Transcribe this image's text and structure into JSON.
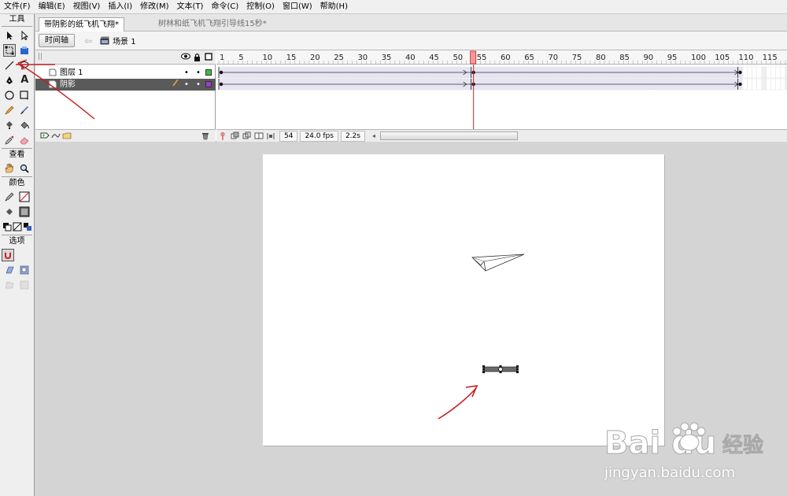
{
  "menu": [
    "文件(F)",
    "编辑(E)",
    "视图(V)",
    "插入(I)",
    "修改(M)",
    "文本(T)",
    "命令(C)",
    "控制(O)",
    "窗口(W)",
    "帮助(H)"
  ],
  "tools": {
    "title": "工具",
    "view_title": "查看",
    "color_title": "颜色",
    "options_title": "选项"
  },
  "tabs": {
    "active": "带阴影的纸飞机飞翔*",
    "inactive": "树林和纸飞机飞翔引导线15秒*"
  },
  "editbar": {
    "timeline_button": "时间轴",
    "scene": "场景 1"
  },
  "timeline": {
    "ruler_numbers": [
      "1",
      "5",
      "10",
      "15",
      "20",
      "25",
      "30",
      "35",
      "40",
      "45",
      "50",
      "55",
      "60",
      "65",
      "70",
      "75",
      "80",
      "85",
      "90",
      "95",
      "100",
      "105",
      "110",
      "115"
    ],
    "playhead_frame": 54,
    "total_frames_shown": 120,
    "layers": [
      {
        "name": "图层 1",
        "dot1": "•",
        "dot2": "•",
        "color": "#3cc03c",
        "selected": false
      },
      {
        "name": "阴影",
        "dot1": "•",
        "dot2": "•",
        "color": "#9b3ccf",
        "selected": true
      }
    ],
    "current_frame": "54",
    "fps": "24.0 fps",
    "time": "2.2s"
  },
  "watermark": {
    "brand": "Bai du",
    "brand_cn": "经验",
    "url": "jingyan.baidu.com"
  }
}
